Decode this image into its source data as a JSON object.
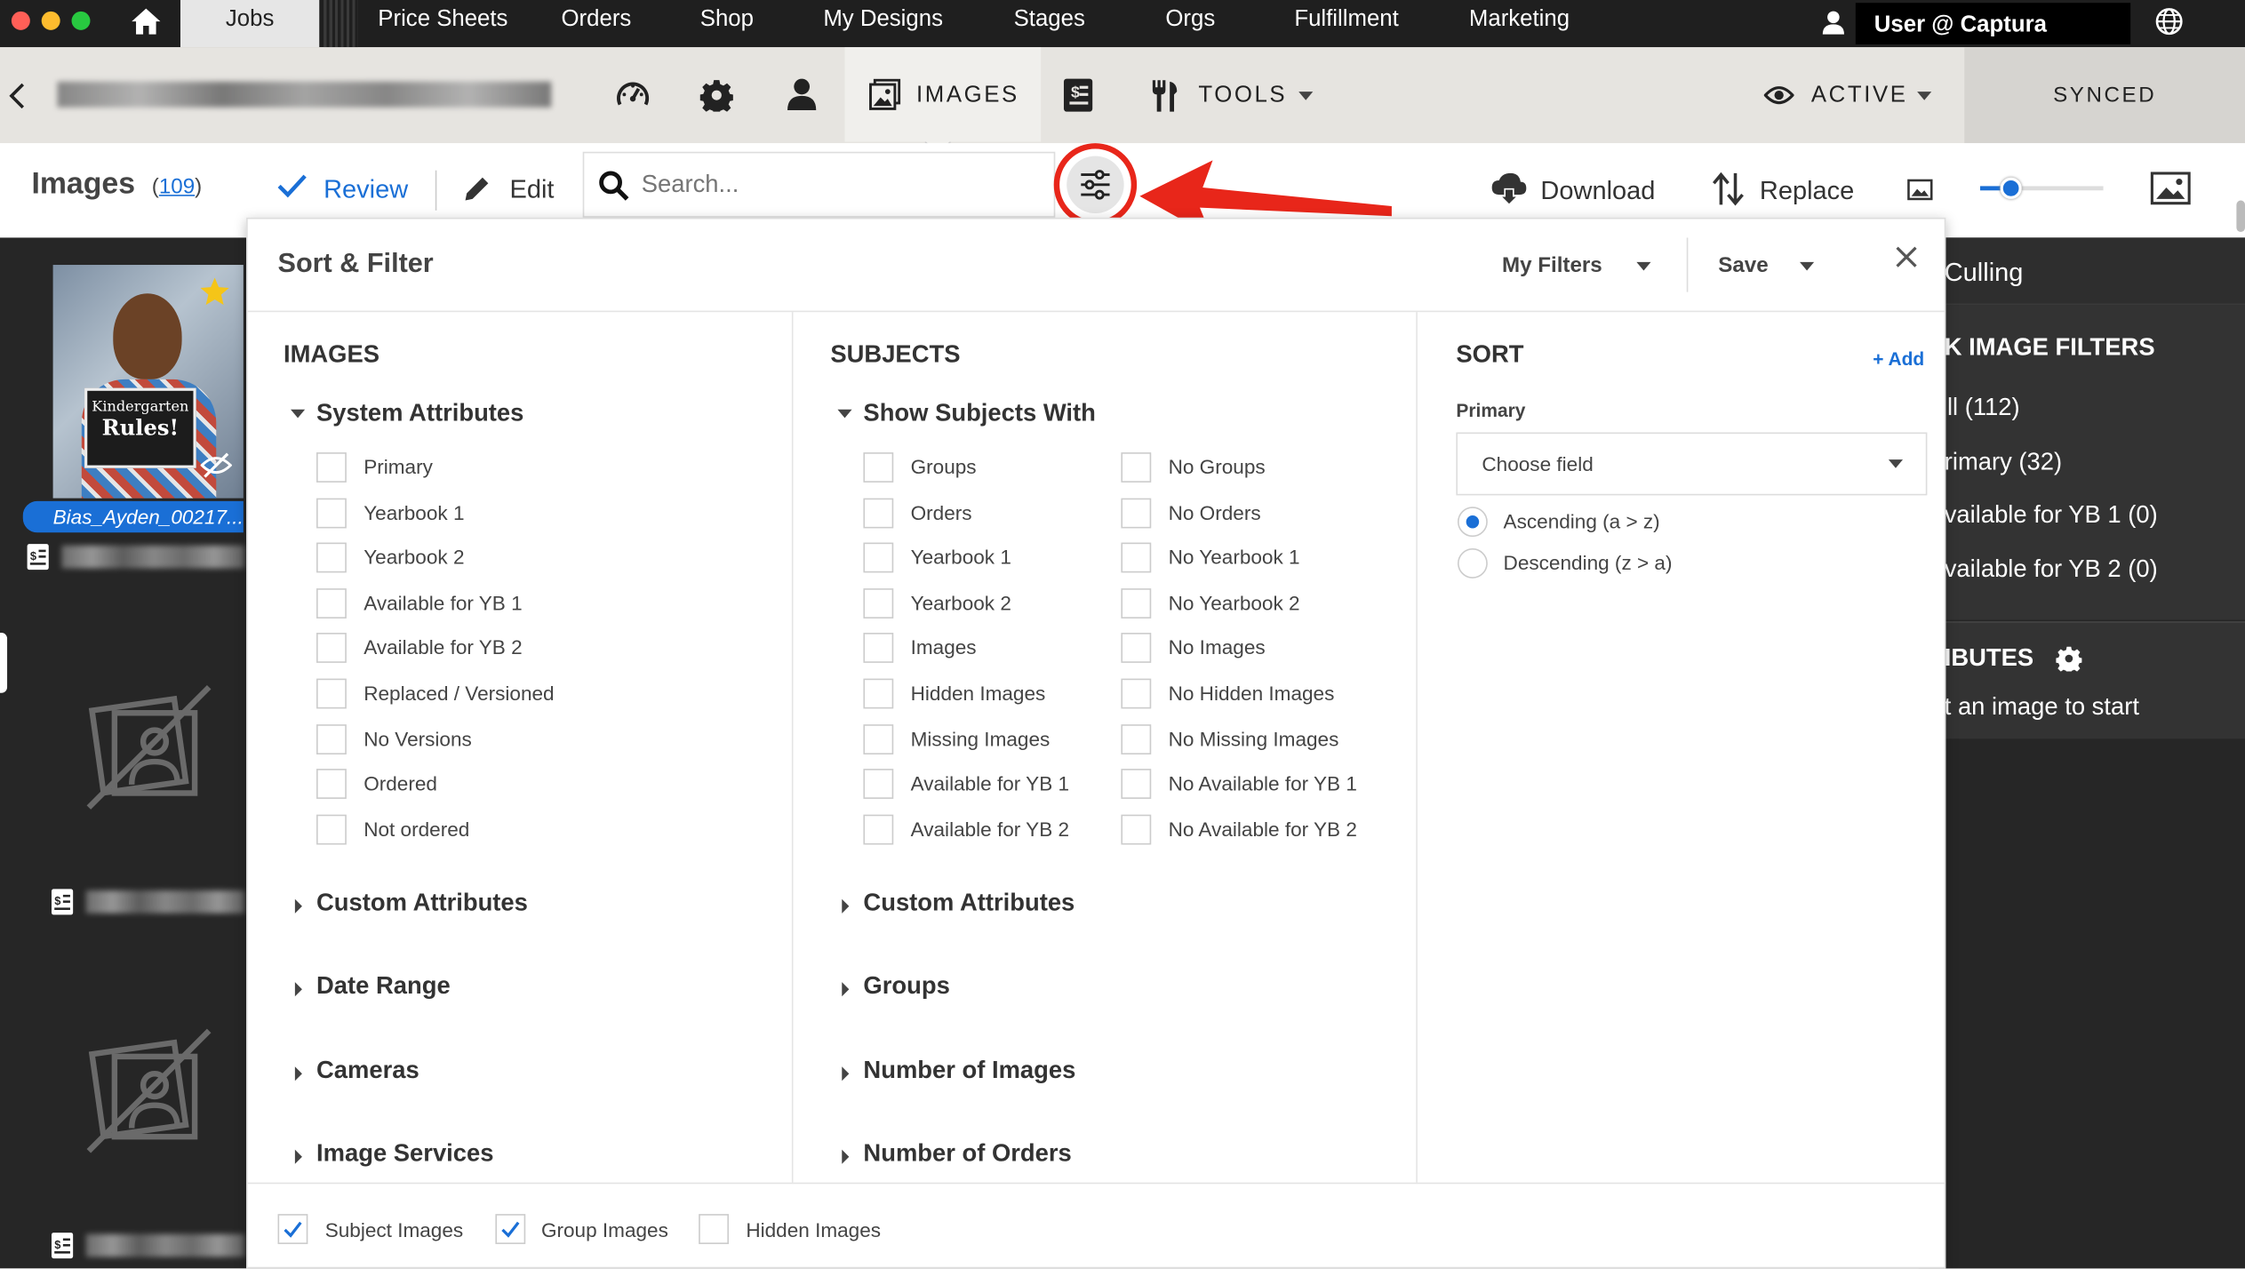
{
  "topnav": {
    "jobs": "Jobs",
    "items": [
      "Price Sheets",
      "Orders",
      "Shop",
      "My Designs",
      "Stages",
      "Orgs",
      "Fulfillment",
      "Marketing"
    ],
    "user": "User @ Captura"
  },
  "jobbar": {
    "images_tab": "IMAGES",
    "tools": "TOOLS",
    "active": "ACTIVE",
    "synced": "SYNCED"
  },
  "toolbar": {
    "title": "Images",
    "count": "109",
    "review": "Review",
    "edit": "Edit",
    "search_placeholder": "Search...",
    "download": "Download",
    "replace": "Replace",
    "zoom_level": 0.25
  },
  "thumbnail": {
    "filename": "Bias_Ayden_00217...",
    "sign_line1": "Kindergarten",
    "sign_line2": "Rules!"
  },
  "right_panel": {
    "culling": "Culling",
    "filters_heading": "K IMAGE FILTERS",
    "filters": [
      "ll (112)",
      "rimary (32)",
      "vailable for YB 1 (0)",
      "vailable for YB 2 (0)"
    ],
    "attributes_heading": "IBUTES",
    "attributes_hint": "t an image to start"
  },
  "panel": {
    "title": "Sort & Filter",
    "my_filters": "My Filters",
    "save": "Save",
    "images": {
      "heading": "IMAGES",
      "group": "System Attributes",
      "options": [
        "Primary",
        "Yearbook 1",
        "Yearbook 2",
        "Available for YB 1",
        "Available for YB 2",
        "Replaced / Versioned",
        "No Versions",
        "Ordered",
        "Not ordered"
      ],
      "collapsed": [
        "Custom Attributes",
        "Date Range",
        "Cameras",
        "Image Services"
      ]
    },
    "subjects": {
      "heading": "SUBJECTS",
      "group": "Show Subjects With",
      "left": [
        "Groups",
        "Orders",
        "Yearbook 1",
        "Yearbook 2",
        "Images",
        "Hidden Images",
        "Missing Images",
        "Available for YB 1",
        "Available for YB 2"
      ],
      "right": [
        "No Groups",
        "No Orders",
        "No Yearbook 1",
        "No Yearbook 2",
        "No Images",
        "No Hidden Images",
        "No Missing Images",
        "No Available for YB 1",
        "No Available for YB 2"
      ],
      "collapsed": [
        "Custom Attributes",
        "Groups",
        "Number of Images",
        "Number of Orders"
      ]
    },
    "sort": {
      "heading": "SORT",
      "add": "+ Add",
      "primary_label": "Primary",
      "field_placeholder": "Choose field",
      "ascending": "Ascending (a > z)",
      "descending": "Descending (z > a)"
    },
    "footer": {
      "subject_images": "Subject Images",
      "group_images": "Group Images",
      "hidden_images": "Hidden Images"
    }
  },
  "colors": {
    "accent": "#1a6fd6",
    "highlight": "#e8261a",
    "topbar": "#1f1f1f"
  }
}
